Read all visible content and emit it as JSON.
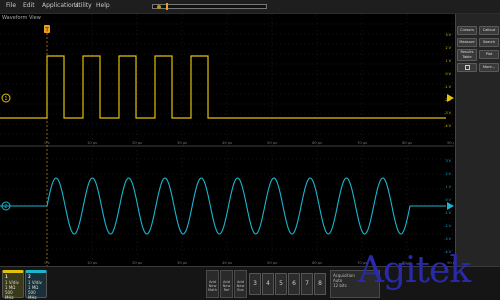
{
  "menu": {
    "items": [
      "File",
      "Edit",
      "Applications",
      "Utility",
      "Help"
    ]
  },
  "view": {
    "label": "Waveform View"
  },
  "trigger": {
    "marker": "T"
  },
  "channels": {
    "ch1": {
      "tag": "1",
      "color": "#e2c10a",
      "lines": [
        "1 V/div",
        "1 MΩ",
        "500 MHz"
      ]
    },
    "ch2": {
      "tag": "2",
      "color": "#19b6d0",
      "lines": [
        "1 V/div",
        "1 MΩ",
        "500 MHz"
      ]
    }
  },
  "right_scale": [
    "3 V",
    "2 V",
    "1 V",
    "0 V",
    "-1 V",
    "-2 V",
    "-3 V",
    "-4 V"
  ],
  "time_ticks": [
    "0 s",
    "10 µs",
    "20 µs",
    "30 µs",
    "40 µs",
    "50 µs",
    "60 µs",
    "70 µs",
    "80 µs",
    "90 µs"
  ],
  "panel": {
    "buttons": [
      {
        "id": "cursors",
        "label": "Cursors"
      },
      {
        "id": "callout",
        "label": "Callout"
      },
      {
        "id": "measure",
        "label": "Measure"
      },
      {
        "id": "search",
        "label": "Search"
      },
      {
        "id": "results-table",
        "label": "Results Table"
      },
      {
        "id": "plot",
        "label": "Plot"
      },
      {
        "id": "more",
        "label": "More..."
      }
    ]
  },
  "bottom": {
    "new_buttons": [
      "Add New Math",
      "Add New Ref",
      "Add New Bus"
    ],
    "numbers": [
      "3",
      "4",
      "5",
      "6",
      "7",
      "8"
    ],
    "acq": [
      "Acquisition",
      "Auto",
      "12 bits"
    ]
  },
  "watermark": "Agitek"
}
